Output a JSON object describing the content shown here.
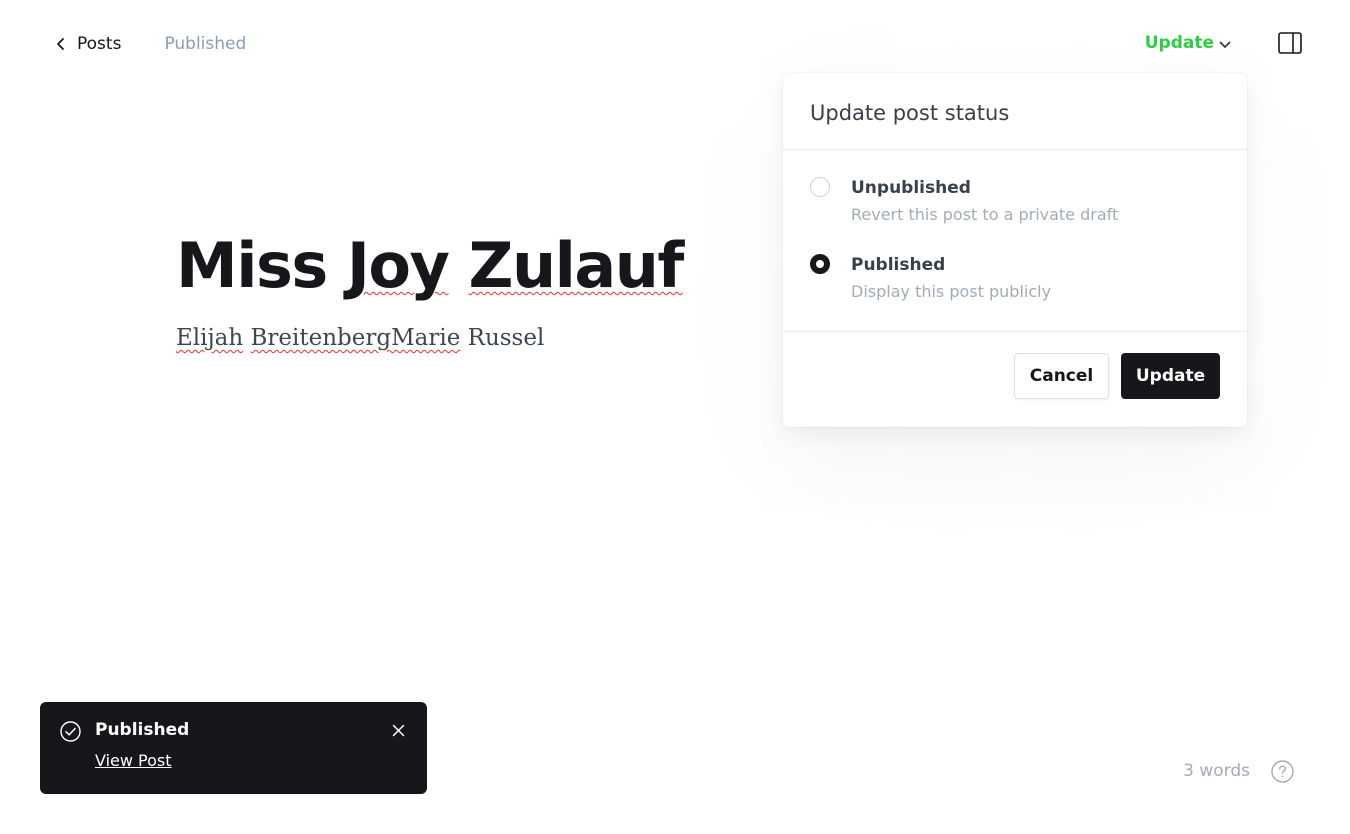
{
  "topbar": {
    "back_label": "Posts",
    "status": "Published",
    "update_label": "Update"
  },
  "editor": {
    "title": "Miss Joy Zulauf",
    "body_words": [
      "Elijah",
      "Breitenberg",
      "Marie",
      "Russel"
    ]
  },
  "popover": {
    "title": "Update post status",
    "options": [
      {
        "label": "Unpublished",
        "description": "Revert this post to a private draft",
        "selected": false
      },
      {
        "label": "Published",
        "description": "Display this post publicly",
        "selected": true
      }
    ],
    "cancel_label": "Cancel",
    "update_label": "Update"
  },
  "toast": {
    "title": "Published",
    "link_label": "View Post"
  },
  "footer": {
    "word_count": "3 words"
  },
  "colors": {
    "accent_green": "#30cf43",
    "dark": "#15171a",
    "muted": "#8e9cac"
  },
  "icons": [
    "chevron-left-icon",
    "chevron-down-icon",
    "sidebar-panel-icon",
    "check-circle-icon",
    "close-icon",
    "help-icon"
  ]
}
